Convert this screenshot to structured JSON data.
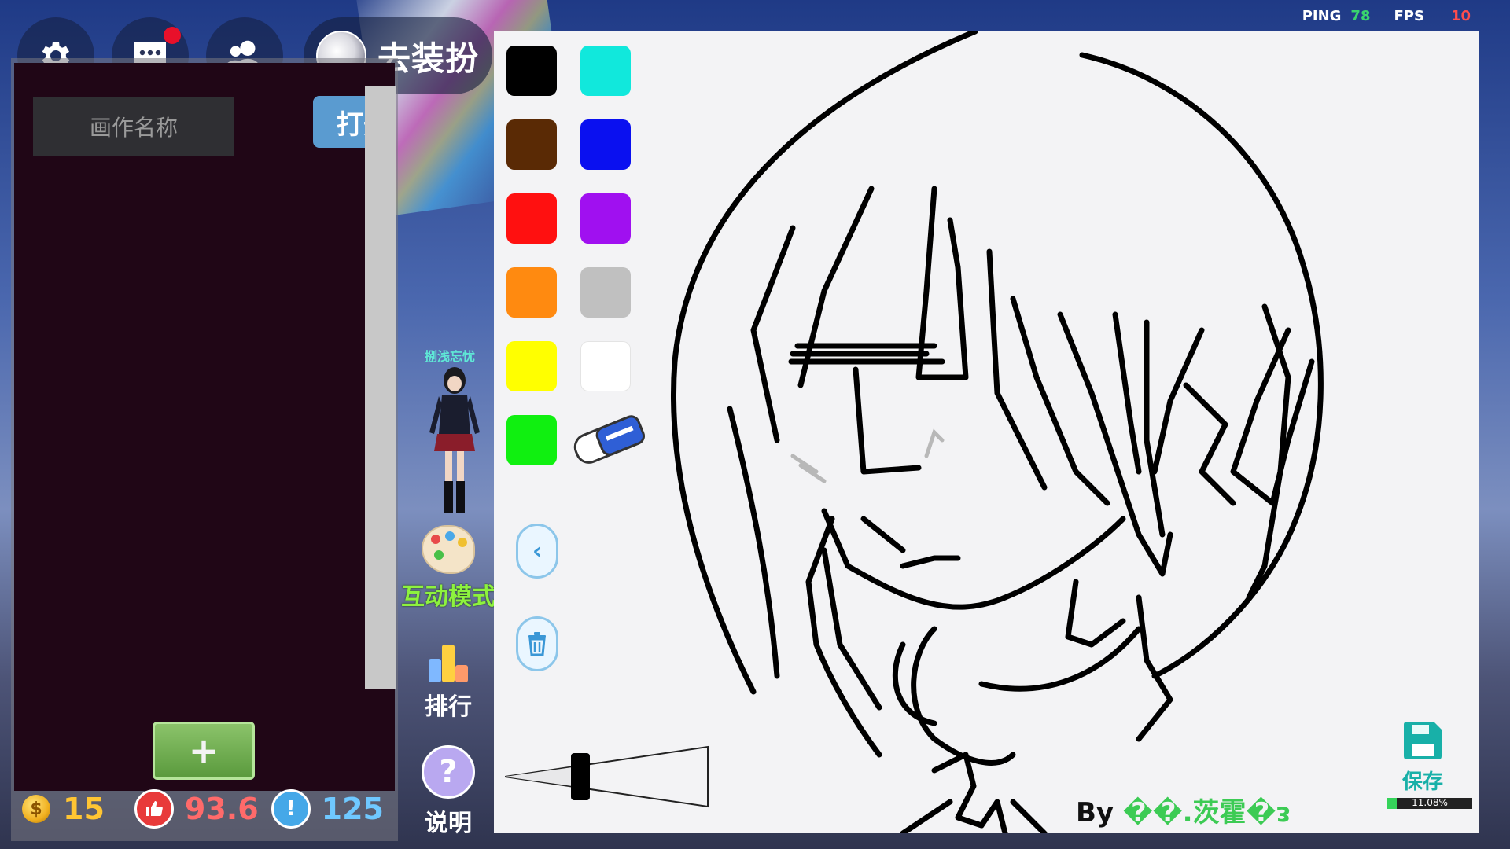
{
  "hud": {
    "dress_label": "去装扮",
    "ping_label": "PING",
    "ping_value": "78",
    "fps_label": "FPS",
    "fps_value": "10"
  },
  "left_panel": {
    "title_placeholder": "画作名称",
    "open_button_label": "打开",
    "add_button_label": "+"
  },
  "stats": {
    "coins": "15",
    "likes": "93.6",
    "alerts": "125"
  },
  "middle": {
    "character_name": "捌浅忘忧",
    "interactive_label": "互动模式",
    "rank_label": "排行",
    "help_label": "说明"
  },
  "board": {
    "colors": [
      "#000000",
      "#11e8dc",
      "#5a2a05",
      "#0a10f0",
      "#ff1010",
      "#a010f0",
      "#ff8a10",
      "#c0c0c0",
      "#ffff00",
      "#ffffff",
      "#10f010"
    ],
    "save_label": "保存",
    "save_progress_text": "11.08%",
    "save_progress": 0.1108,
    "by_prefix": "By",
    "author": "��.茨霍�ᴈ"
  },
  "icons": [
    "gear-icon",
    "chat-icon",
    "friends-icon",
    "avatar",
    "palette-icon",
    "rank-icon",
    "help-icon",
    "eraser-icon",
    "back-icon",
    "trash-icon",
    "save-icon",
    "coin-icon",
    "like-icon",
    "alert-icon"
  ]
}
